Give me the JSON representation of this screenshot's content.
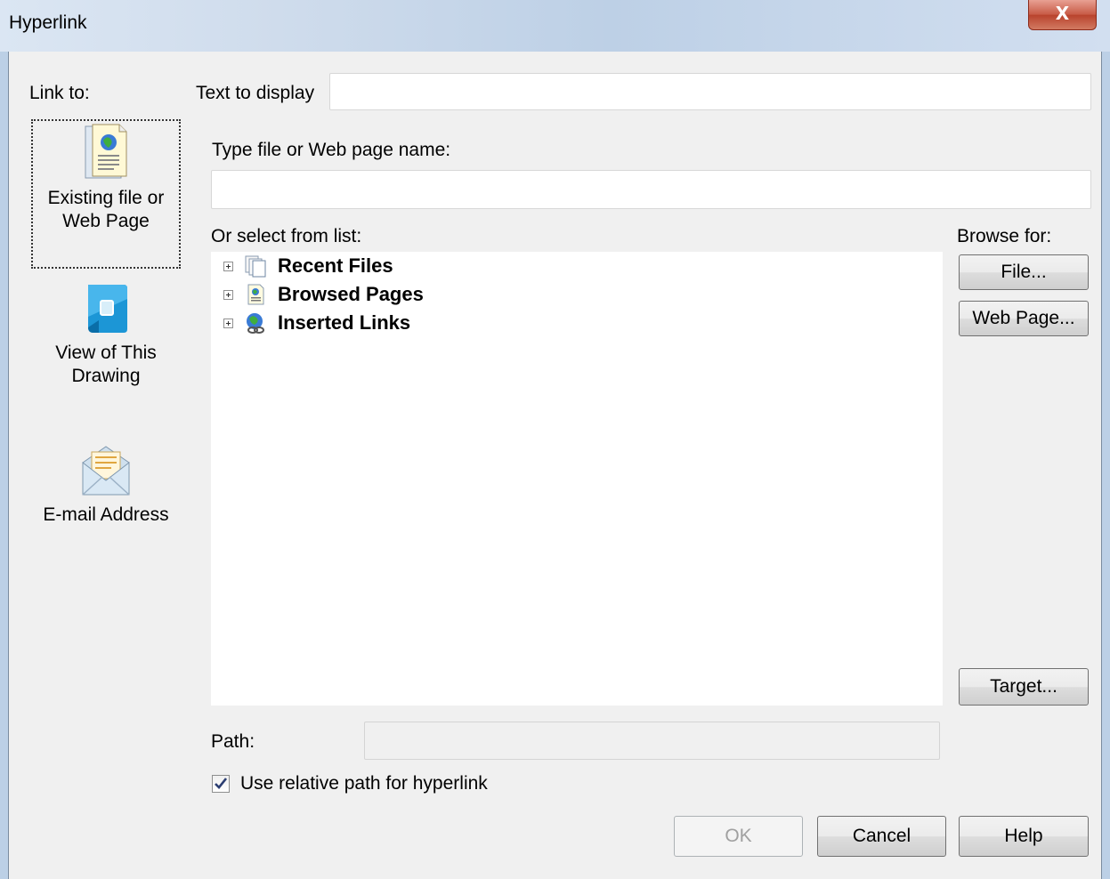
{
  "window": {
    "title": "Hyperlink",
    "close_glyph": "X"
  },
  "link_to": {
    "label": "Link to:",
    "options": [
      {
        "label_line1": "Existing file or",
        "label_line2": "Web Page",
        "icon": "web-page-document-icon",
        "selected": true
      },
      {
        "label_line1": "View of This",
        "label_line2": "Drawing",
        "icon": "drawing-view-icon",
        "selected": false
      },
      {
        "label_line1": "E-mail Address",
        "label_line2": "",
        "icon": "email-envelope-icon",
        "selected": false
      }
    ]
  },
  "text_to_display": {
    "label": "Text to display",
    "value": ""
  },
  "file_name": {
    "label": "Type file or Web page name:",
    "value": ""
  },
  "select_list": {
    "label": "Or select from list:",
    "items": [
      {
        "label": "Recent Files",
        "icon": "recent-files-icon"
      },
      {
        "label": "Browsed Pages",
        "icon": "browsed-pages-icon"
      },
      {
        "label": "Inserted Links",
        "icon": "inserted-links-icon"
      }
    ]
  },
  "browse": {
    "label": "Browse for:",
    "file_button": "File...",
    "web_page_button": "Web Page...",
    "target_button": "Target..."
  },
  "path": {
    "label": "Path:",
    "value": ""
  },
  "relative_path": {
    "label": "Use relative path for hyperlink",
    "checked": true
  },
  "buttons": {
    "ok": "OK",
    "cancel": "Cancel",
    "help": "Help",
    "ok_enabled": false
  },
  "colors": {
    "title_bar": "#cfdcec",
    "close_button": "#c75a45",
    "dialog_bg": "#f0f0f0",
    "list_bg": "#ffffff"
  }
}
